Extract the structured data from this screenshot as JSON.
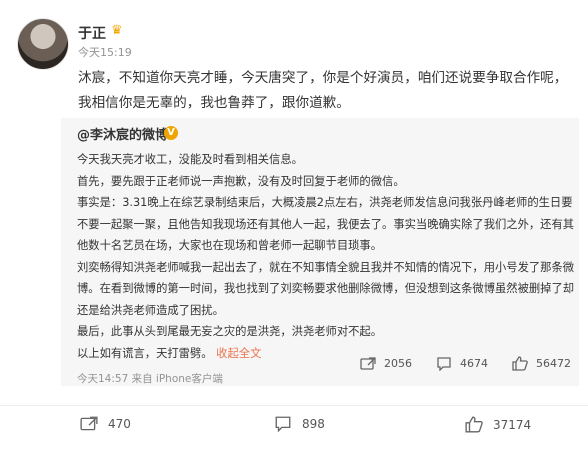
{
  "post": {
    "author": "于正",
    "time": "今天15:19",
    "text": "沐宸，不知道你天亮才睡，今天唐突了，你是个好演员，咱们还说要争取合作呢，我相信你是无辜的，我也鲁莽了，跟你道歉。"
  },
  "quoted": {
    "author": "@李沐宸的微博",
    "paragraphs": [
      "今天我天亮才收工，没能及时看到相关信息。",
      "首先，要先跟于正老师说一声抱歉，没有及时回复于老师的微信。",
      "事实是：3.31晚上在综艺录制结束后，大概凌晨2点左右，洪尧老师发信息问我张丹峰老师的生日要不要一起聚一聚，且他告知我现场还有其他人一起，我便去了。事实当晚确实除了我们之外，还有其他数十名艺员在场，大家也在现场和曾老师一起聊节目琐事。",
      "刘奕畅得知洪尧老师喊我一起出去了，就在不知事情全貌且我并不知情的情况下，用小号发了那条微博。在看到微博的第一时间，我也找到了刘奕畅要求他删除微博，但没想到这条微博虽然被删掉了却还是给洪尧老师造成了困扰。",
      "最后，此事从头到尾最无妄之灾的是洪尧，洪尧老师对不起。"
    ],
    "last_line": "以上如有谎言，天打雷劈。",
    "more_label": "收起全文",
    "meta": "今天14:57 来自 iPhone客户端",
    "actions": {
      "repost": "2056",
      "comment": "4674",
      "like": "56472"
    }
  },
  "footer": {
    "repost": "470",
    "comment": "898",
    "like": "37174"
  }
}
